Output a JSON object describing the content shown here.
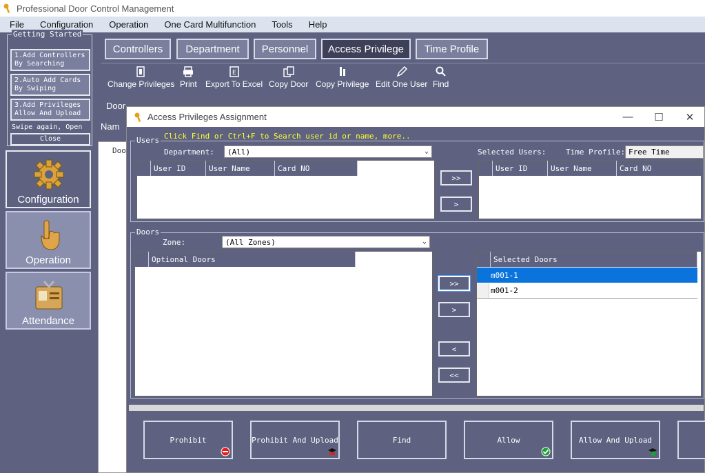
{
  "app": {
    "title": "Professional Door Control Management"
  },
  "menu": [
    "File",
    "Configuration",
    "Operation",
    "One Card Multifunction",
    "Tools",
    "Help"
  ],
  "sidebar": {
    "getting_started_label": "Getting Started",
    "step1": [
      "1.Add Controllers",
      "By Searching"
    ],
    "step2": [
      "2.Auto Add Cards",
      "By Swiping"
    ],
    "step3": [
      "3.Add Privileges",
      "Allow And Upload"
    ],
    "swipe_text": "Swipe again, Open",
    "close_label": "Close",
    "nav": [
      {
        "label": "Configuration",
        "icon": "gear-icon"
      },
      {
        "label": "Operation",
        "icon": "pointing-hand-icon"
      },
      {
        "label": "Attendance",
        "icon": "id-card-icon"
      }
    ]
  },
  "tabs": [
    "Controllers",
    "Department",
    "Personnel",
    "Access Privilege",
    "Time Profile"
  ],
  "toolbar": [
    "Change Privileges",
    "Print",
    "Export To Excel",
    "Copy Door",
    "Copy Privilege",
    "Edit One User",
    "Find"
  ],
  "background_panel": {
    "door_label": "Door",
    "name_label": "Nam",
    "grid_header": "Doo"
  },
  "dialog": {
    "title": "Access Privileges Assignment",
    "users_group": "Users",
    "hint": "Click Find or Ctrl+F  to Search user id or name,  more..",
    "department_label": "Department:",
    "department_value": "(All)",
    "selected_users_label": "Selected Users:",
    "time_profile_label": "Time Profile:",
    "time_profile_value": "Free Time",
    "user_columns": [
      "User ID",
      "User Name",
      "Card NO"
    ],
    "selected_user_columns": [
      "User ID",
      "User Name",
      "Card NO"
    ],
    "doors_group": "Doors",
    "zone_label": "Zone:",
    "zone_value": "(All Zones)",
    "optional_doors_header": "Optional Doors",
    "selected_doors_header": "Selected Doors",
    "selected_doors": [
      "m001-1",
      "m001-2"
    ],
    "move_buttons": {
      "all_right": ">>",
      "right": ">",
      "left": "<",
      "all_left": "<<"
    },
    "actions": [
      "Prohibit",
      "Prohibit And Upload",
      "Find",
      "Allow",
      "Allow And Upload"
    ]
  },
  "colors": {
    "panel": "#5e6280",
    "selection": "#0a74dc",
    "hint": "#ffff33"
  }
}
